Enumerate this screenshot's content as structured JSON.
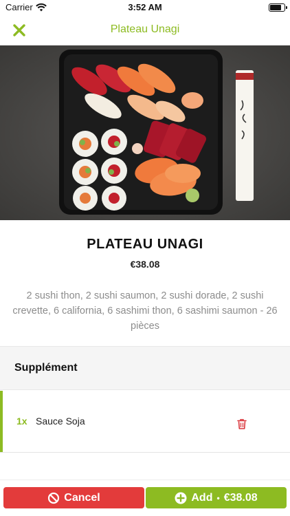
{
  "status_bar": {
    "carrier": "Carrier",
    "time": "3:52 AM",
    "battery_level": 0.8
  },
  "nav": {
    "title": "Plateau Unagi",
    "close_icon": "close-x-icon"
  },
  "product": {
    "name": "PLATEAU UNAGI",
    "price": "€38.08",
    "description": "2 sushi thon, 2 sushi saumon, 2 sushi dorade, 2 sushi crevette, 6 california, 6 sashimi thon, 6 sashimi saumon - 26 pièces"
  },
  "supplement": {
    "title": "Supplément",
    "items": [
      {
        "qty": "1x",
        "name": "Sauce Soja"
      }
    ]
  },
  "actions": {
    "cancel_label": "Cancel",
    "add_label": "Add",
    "separator": "•",
    "add_price": "€38.08"
  },
  "colors": {
    "accent_green": "#8dbb22",
    "cancel_red": "#e33b3b",
    "delete_red": "#d9343a"
  }
}
